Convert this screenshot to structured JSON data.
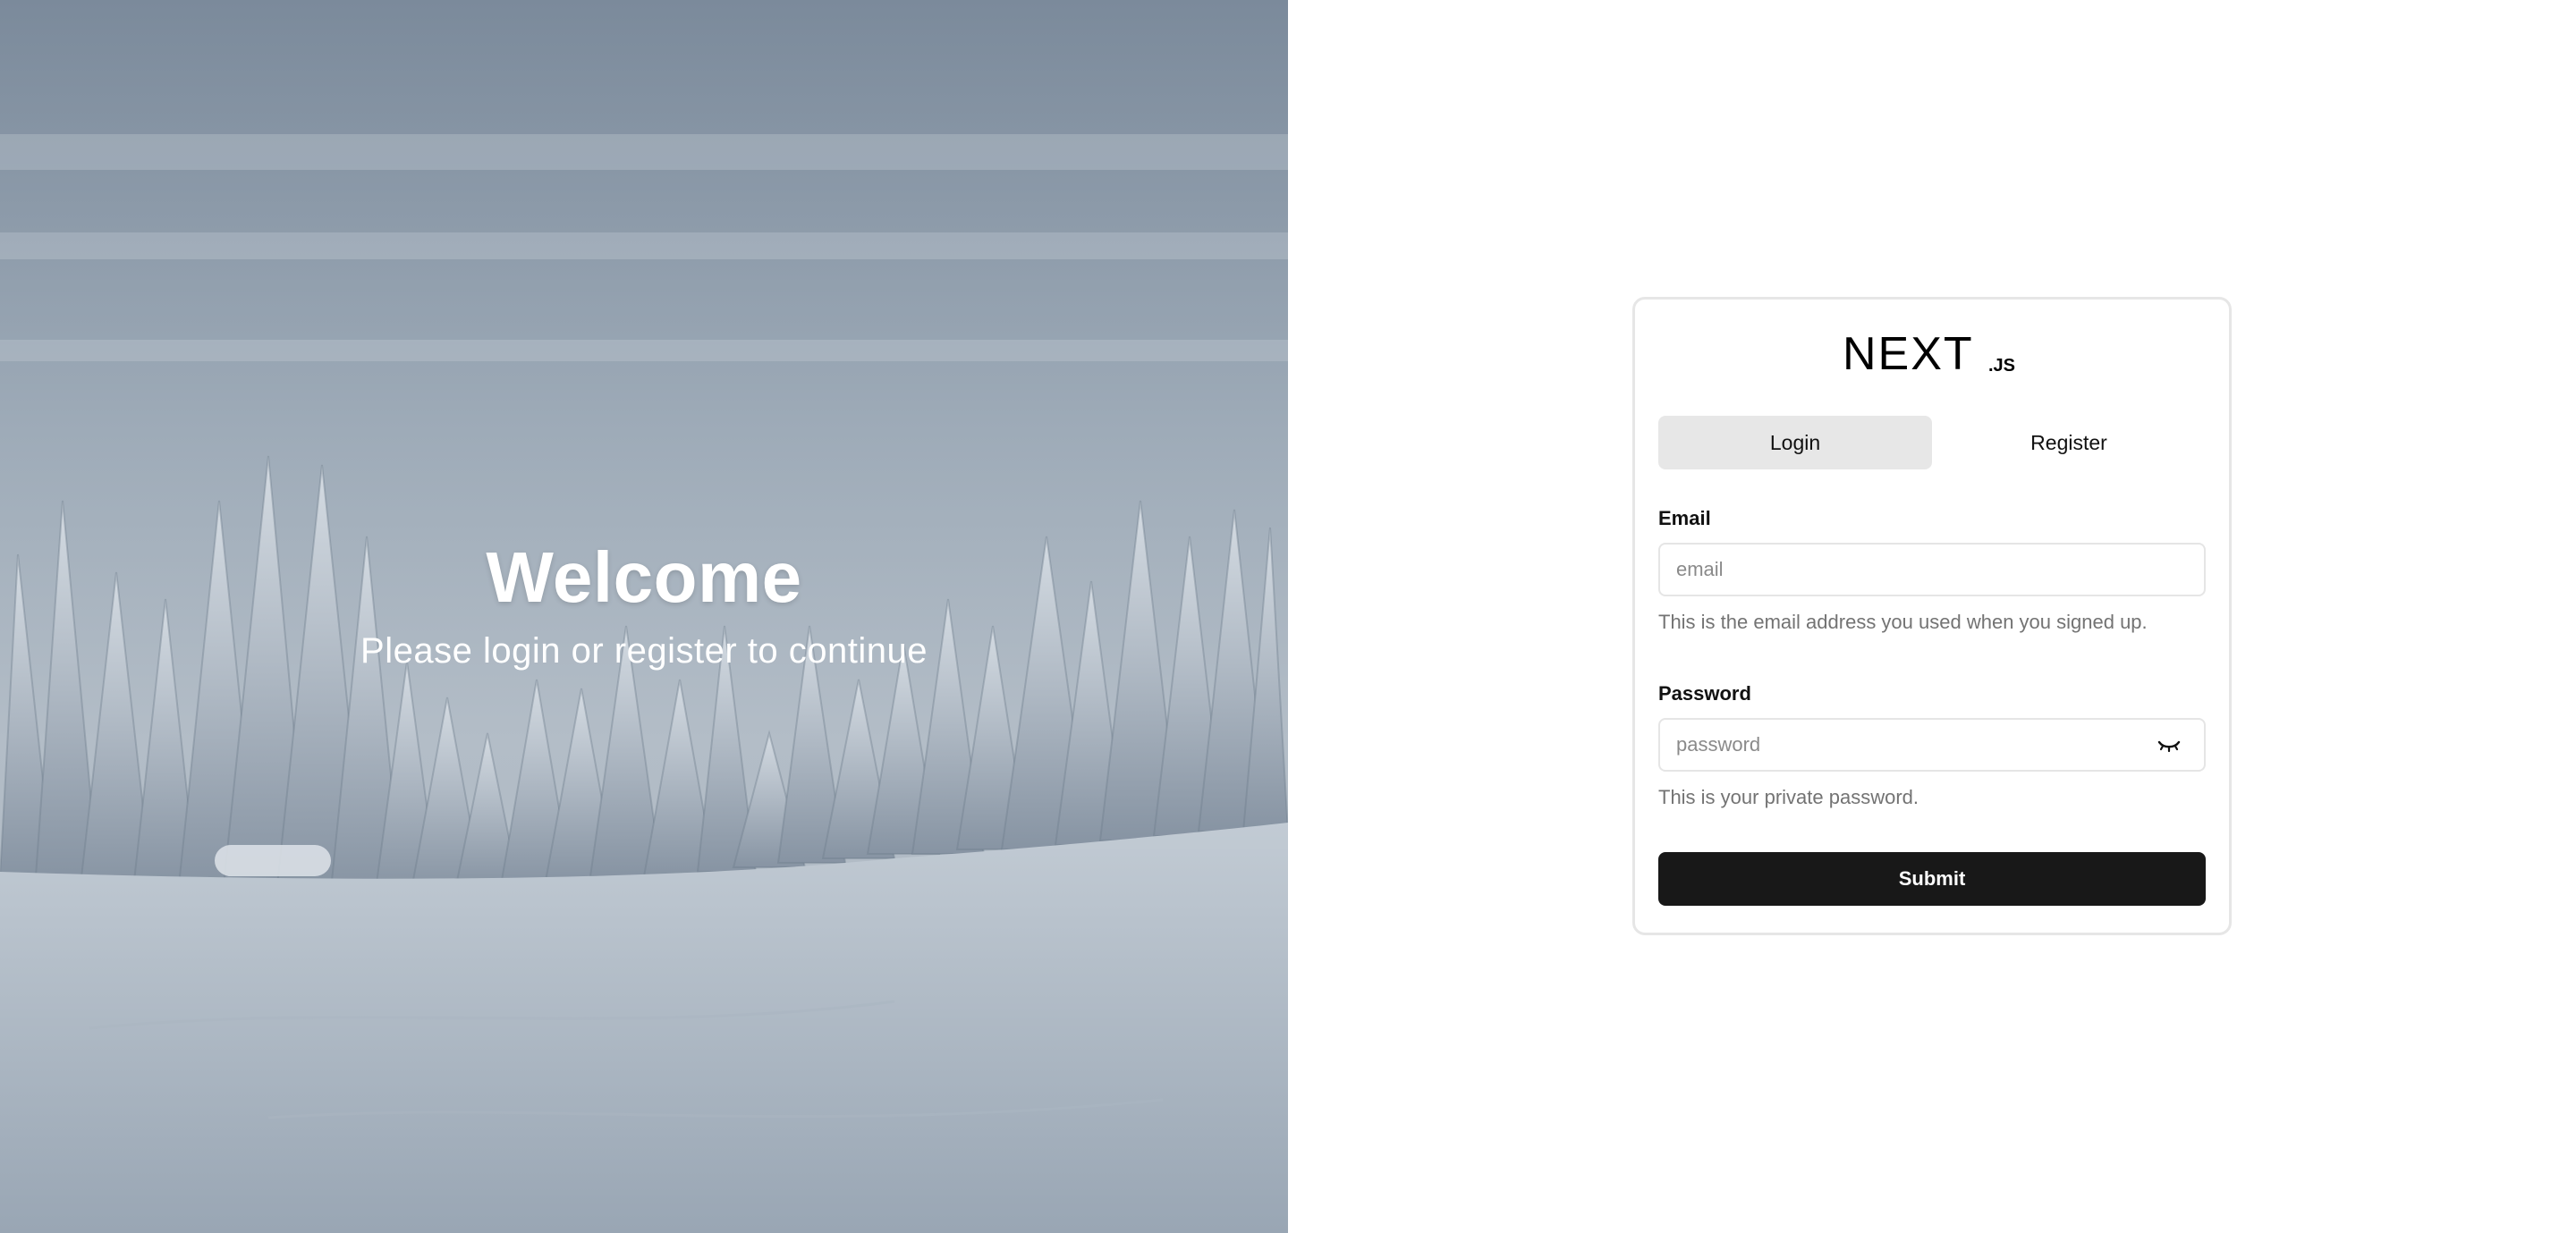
{
  "hero": {
    "title": "Welcome",
    "subtitle": "Please login or register to continue"
  },
  "card": {
    "logo_text": "NEXT",
    "logo_suffix": ".JS",
    "tabs": [
      {
        "label": "Login",
        "active": true
      },
      {
        "label": "Register",
        "active": false
      }
    ],
    "email": {
      "label": "Email",
      "placeholder": "email",
      "value": "",
      "hint": "This is the email address you used when you signed up."
    },
    "password": {
      "label": "Password",
      "placeholder": "password",
      "value": "",
      "hint": "This is your private password.",
      "toggle_icon": "eye-closed-icon"
    },
    "submit_label": "Submit"
  },
  "colors": {
    "submit_bg": "#181818",
    "active_tab_bg": "#e7e7e7",
    "hint_text": "#737373",
    "card_border": "#e6e6e6"
  }
}
